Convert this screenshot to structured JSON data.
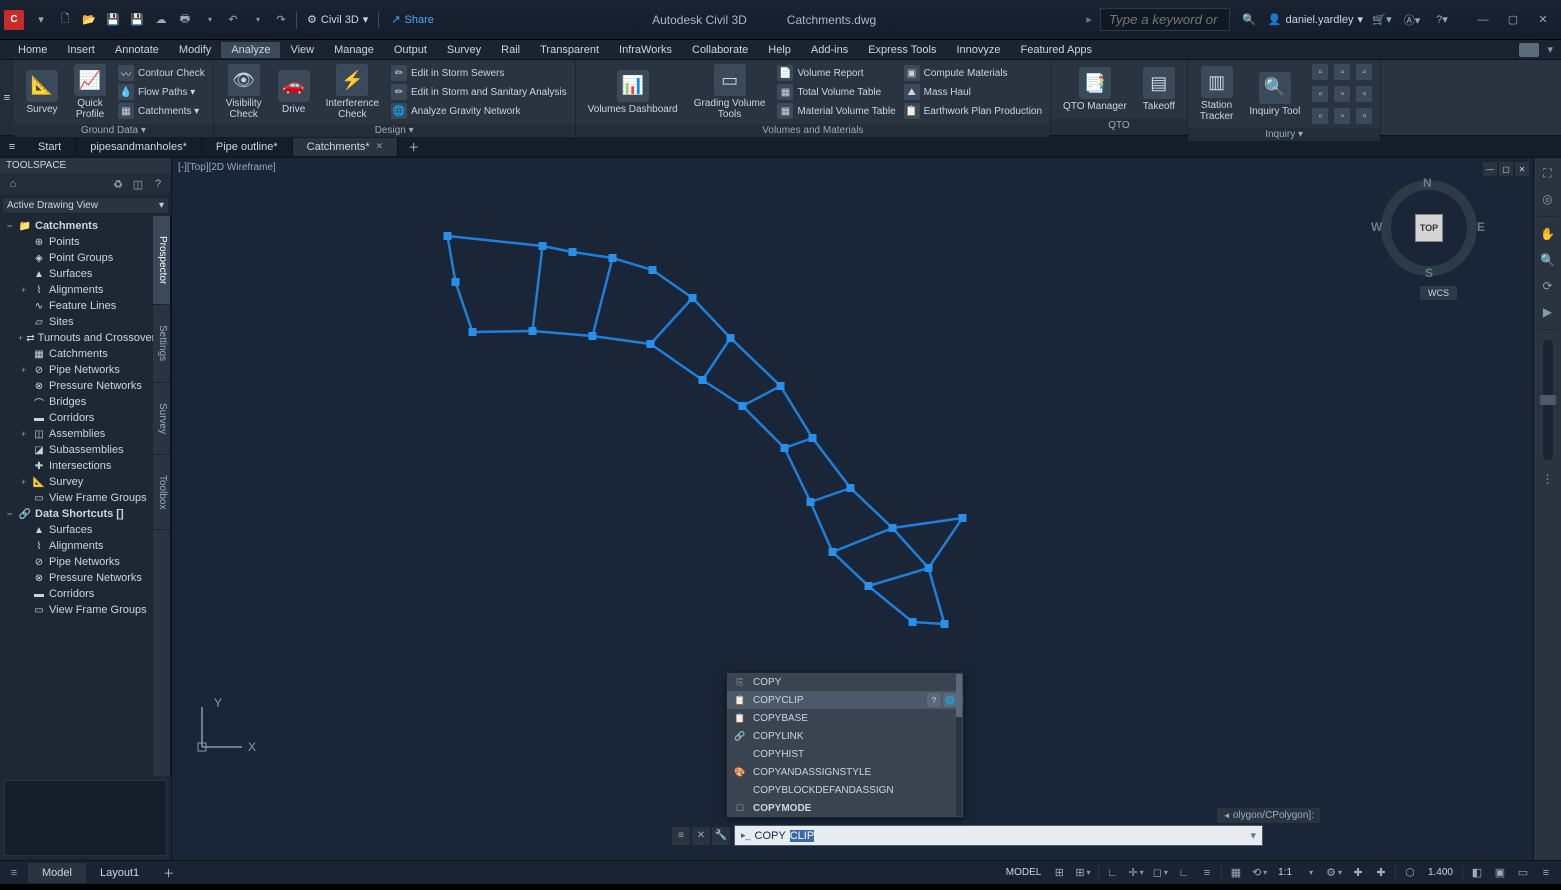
{
  "app": {
    "icon_letter": "C",
    "product": "Autodesk Civil 3D",
    "file": "Catchments.dwg",
    "workspace": "Civil 3D",
    "share": "Share",
    "search_placeholder": "Type a keyword or phrase",
    "user": "daniel.yardley"
  },
  "menus": [
    "Home",
    "Insert",
    "Annotate",
    "Modify",
    "Analyze",
    "View",
    "Manage",
    "Output",
    "Survey",
    "Rail",
    "Transparent",
    "InfraWorks",
    "Collaborate",
    "Help",
    "Add-ins",
    "Express Tools",
    "Innovyze",
    "Featured Apps"
  ],
  "active_menu": 4,
  "ribbon": {
    "panels": [
      {
        "title": "Ground Data ▾",
        "big": [
          {
            "label": "Survey",
            "icon": "📐"
          },
          {
            "label": "Quick\nProfile",
            "icon": "📈"
          }
        ],
        "rows": [
          {
            "label": "Contour Check",
            "icon": "〰"
          },
          {
            "label": "Flow Paths ▾",
            "icon": "💧"
          },
          {
            "label": "Catchments ▾",
            "icon": "▦"
          }
        ]
      },
      {
        "title": "Design ▾",
        "big": [
          {
            "label": "Visibility\nCheck",
            "icon": "👁"
          },
          {
            "label": "Drive",
            "icon": "🚗"
          },
          {
            "label": "Interference\nCheck",
            "icon": "⚡"
          }
        ],
        "rows": [
          {
            "label": "Edit in Storm Sewers",
            "icon": "✏"
          },
          {
            "label": "Edit in Storm and Sanitary Analysis",
            "icon": "✏"
          },
          {
            "label": "Analyze Gravity Network",
            "icon": "🌐"
          }
        ]
      },
      {
        "title": "Volumes and Materials",
        "big": [
          {
            "label": "Volumes Dashboard",
            "icon": "📊"
          },
          {
            "label": "Grading Volume\nTools",
            "icon": "▭"
          }
        ],
        "rows": [
          {
            "label": "Volume Report",
            "icon": "📄"
          },
          {
            "label": "Total Volume Table",
            "icon": "▦"
          },
          {
            "label": "Material Volume Table",
            "icon": "▦"
          }
        ],
        "rows2": [
          {
            "label": "Compute Materials",
            "icon": "▣"
          },
          {
            "label": "Mass Haul",
            "icon": "⛰"
          },
          {
            "label": "Earthwork Plan Production",
            "icon": "📋"
          }
        ]
      },
      {
        "title": "QTO",
        "big": [
          {
            "label": "QTO Manager",
            "icon": "📑"
          },
          {
            "label": "Takeoff",
            "icon": "▤"
          }
        ]
      },
      {
        "title": "Inquiry ▾",
        "big": [
          {
            "label": "Station\nTracker",
            "icon": "▥"
          },
          {
            "label": "Inquiry Tool",
            "icon": "🔍"
          }
        ],
        "grid": [
          "▫",
          "▫",
          "▫",
          "▫",
          "▫",
          "▫",
          "▫",
          "▫",
          "▫"
        ]
      }
    ]
  },
  "filetabs": {
    "start": "Start",
    "tabs": [
      "pipesandmanholes*",
      "Pipe outline*",
      "Catchments*"
    ],
    "active": 2
  },
  "toolspace": {
    "title": "TOOLSPACE",
    "view": "Active Drawing View",
    "vtabs": [
      "Prospector",
      "Settings",
      "Survey",
      "Toolbox"
    ],
    "active_vtab": 0,
    "tree": [
      {
        "depth": 0,
        "label": "Catchments",
        "expand": "−",
        "icon": "📁",
        "root": true
      },
      {
        "depth": 1,
        "label": "Points",
        "expand": "",
        "icon": "⊕"
      },
      {
        "depth": 1,
        "label": "Point Groups",
        "expand": "",
        "icon": "◈"
      },
      {
        "depth": 1,
        "label": "Surfaces",
        "expand": "",
        "icon": "▲"
      },
      {
        "depth": 1,
        "label": "Alignments",
        "expand": "+",
        "icon": "⌇"
      },
      {
        "depth": 1,
        "label": "Feature Lines",
        "expand": "",
        "icon": "∿"
      },
      {
        "depth": 1,
        "label": "Sites",
        "expand": "",
        "icon": "▱"
      },
      {
        "depth": 1,
        "label": "Turnouts and Crossovers",
        "expand": "+",
        "icon": "⇄"
      },
      {
        "depth": 1,
        "label": "Catchments",
        "expand": "",
        "icon": "▦"
      },
      {
        "depth": 1,
        "label": "Pipe Networks",
        "expand": "+",
        "icon": "⊘"
      },
      {
        "depth": 1,
        "label": "Pressure Networks",
        "expand": "",
        "icon": "⊗"
      },
      {
        "depth": 1,
        "label": "Bridges",
        "expand": "",
        "icon": "⌒"
      },
      {
        "depth": 1,
        "label": "Corridors",
        "expand": "",
        "icon": "▬"
      },
      {
        "depth": 1,
        "label": "Assemblies",
        "expand": "+",
        "icon": "◫"
      },
      {
        "depth": 1,
        "label": "Subassemblies",
        "expand": "",
        "icon": "◪"
      },
      {
        "depth": 1,
        "label": "Intersections",
        "expand": "",
        "icon": "✚"
      },
      {
        "depth": 1,
        "label": "Survey",
        "expand": "+",
        "icon": "📐"
      },
      {
        "depth": 1,
        "label": "View Frame Groups",
        "expand": "",
        "icon": "▭"
      },
      {
        "depth": 0,
        "label": "Data Shortcuts []",
        "expand": "−",
        "icon": "🔗",
        "root": true
      },
      {
        "depth": 1,
        "label": "Surfaces",
        "expand": "",
        "icon": "▲"
      },
      {
        "depth": 1,
        "label": "Alignments",
        "expand": "",
        "icon": "⌇"
      },
      {
        "depth": 1,
        "label": "Pipe Networks",
        "expand": "",
        "icon": "⊘"
      },
      {
        "depth": 1,
        "label": "Pressure Networks",
        "expand": "",
        "icon": "⊗"
      },
      {
        "depth": 1,
        "label": "Corridors",
        "expand": "",
        "icon": "▬"
      },
      {
        "depth": 1,
        "label": "View Frame Groups",
        "expand": "",
        "icon": "▭"
      }
    ]
  },
  "viewport": {
    "label": "[-][Top][2D Wireframe]",
    "cube_face": "TOP",
    "dirs": {
      "n": "N",
      "s": "S",
      "e": "E",
      "w": "W"
    },
    "wcs": "WCS",
    "ucs_x": "X",
    "ucs_y": "Y"
  },
  "autocomplete": {
    "hl_index": 1,
    "items": [
      {
        "label": "COPY",
        "icon": "⎘"
      },
      {
        "label": "COPYCLIP",
        "icon": "📋",
        "extras": true
      },
      {
        "label": "COPYBASE",
        "icon": "📋"
      },
      {
        "label": "COPYLINK",
        "icon": "🔗"
      },
      {
        "label": "COPYHIST",
        "icon": ""
      },
      {
        "label": "COPYANDASSIGNSTYLE",
        "icon": "🎨"
      },
      {
        "label": "COPYBLOCKDEFANDASSIGN",
        "icon": ""
      },
      {
        "label": "COPYMODE",
        "icon": "☐",
        "bold": true
      }
    ]
  },
  "cmdline": {
    "typed": "COPY",
    "selected": "CLIP",
    "history": "olygon/CPolygon]:"
  },
  "modeltabs": {
    "tabs": [
      "Model",
      "Layout1"
    ],
    "active": 0
  },
  "status": {
    "space": "MODEL",
    "scale": "1:1",
    "zoom": "1.400"
  }
}
